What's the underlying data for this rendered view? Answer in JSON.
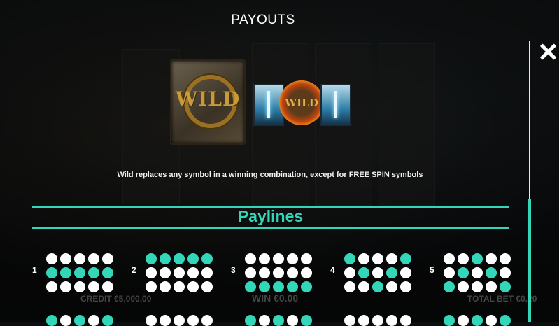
{
  "title": "PAYOUTS",
  "wild_symbol": {
    "label": "WILD"
  },
  "wild_expanded": {
    "label": "WILD"
  },
  "description": "Wild replaces any symbol in a winning combination, except for FREE SPIN symbols",
  "paylines_heading": "Paylines",
  "paylines": [
    {
      "number": "1",
      "rows": [
        [
          0,
          0,
          0,
          0,
          0
        ],
        [
          1,
          1,
          1,
          1,
          1
        ],
        [
          0,
          0,
          0,
          0,
          0
        ]
      ]
    },
    {
      "number": "2",
      "rows": [
        [
          1,
          1,
          1,
          1,
          1
        ],
        [
          0,
          0,
          0,
          0,
          0
        ],
        [
          0,
          0,
          0,
          0,
          0
        ]
      ]
    },
    {
      "number": "3",
      "rows": [
        [
          0,
          0,
          0,
          0,
          0
        ],
        [
          0,
          0,
          0,
          0,
          0
        ],
        [
          1,
          1,
          1,
          1,
          1
        ]
      ]
    },
    {
      "number": "4",
      "rows": [
        [
          1,
          0,
          0,
          0,
          1
        ],
        [
          0,
          1,
          0,
          1,
          0
        ],
        [
          0,
          0,
          1,
          0,
          0
        ]
      ]
    },
    {
      "number": "5",
      "rows": [
        [
          0,
          0,
          1,
          0,
          0
        ],
        [
          0,
          1,
          0,
          1,
          0
        ],
        [
          1,
          0,
          0,
          0,
          1
        ]
      ]
    }
  ],
  "hud": {
    "credit": "CREDIT €5,000.00",
    "win": "WIN €0.00",
    "total_bet": "TOTAL BET €0.20"
  },
  "colors": {
    "accent": "#33d6b8",
    "inactive_dot": "#ffffff"
  },
  "icons": {
    "close": "close-icon"
  }
}
